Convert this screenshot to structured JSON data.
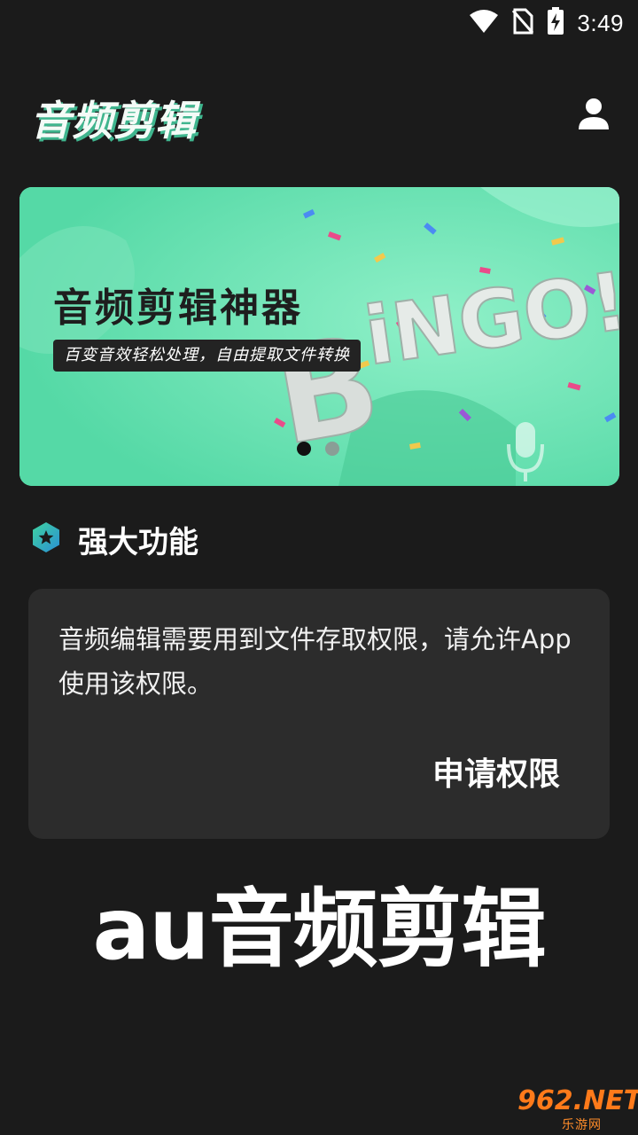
{
  "status_bar": {
    "time": "3:49"
  },
  "header": {
    "title": "音频剪辑"
  },
  "banner": {
    "title": "音频剪辑神器",
    "subtitle": "百变音效轻松处理，自由提取文件转换",
    "bingo_text": "BiNGO!",
    "active_slide": 1,
    "slide_count": 2
  },
  "section": {
    "title": "强大功能"
  },
  "permission_card": {
    "message": "音频编辑需要用到文件存取权限，请允许App使用该权限。",
    "button_label": "申请权限"
  },
  "caption": "au音频剪辑",
  "watermark": {
    "main": "962.NET",
    "sub": "乐游网"
  },
  "colors": {
    "background": "#1b1b1b",
    "card": "#2c2c2c",
    "banner": "#6ee6b5",
    "accent": "#3fb58e"
  }
}
